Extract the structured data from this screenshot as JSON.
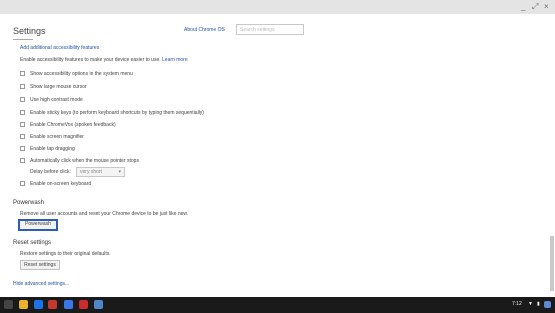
{
  "window": {
    "controls": [
      "_",
      "⤢",
      "×"
    ]
  },
  "header": {
    "title": "Settings",
    "about_link": "About Chrome OS",
    "search_placeholder": "Search settings"
  },
  "accessibility": {
    "link": "Add additional accessibility features",
    "intro": "Enable accessibility features to make your device easier to use.",
    "learn_more": "Learn more",
    "options": [
      "Show accessibility options in the system menu",
      "Show large mouse cursor",
      "Use high contrast mode",
      "Enable sticky keys (to perform keyboard shortcuts by typing them sequentially)",
      "Enable ChromeVox (spoken feedback)",
      "Enable screen magnifier",
      "Enable tap dragging",
      "Automatically click when the mouse pointer stops"
    ],
    "delay_label": "Delay before click:",
    "delay_value": "very short",
    "onscreen_keyboard": "Enable on-screen keyboard"
  },
  "powerwash": {
    "title": "Powerwash",
    "description": "Remove all user accounts and reset your Chrome device to be just like new.",
    "button": "Powerwash"
  },
  "reset": {
    "title": "Reset settings",
    "description": "Restore settings to their original defaults.",
    "button": "Reset settings"
  },
  "hide_advanced": "Hide advanced settings...",
  "shelf": {
    "apps": [
      {
        "name": "chrome-app-icon",
        "color": "#e8b22c"
      },
      {
        "name": "search-app-icon",
        "color": "#1a73e8"
      },
      {
        "name": "gmail-app-icon",
        "color": "#c23a2b"
      },
      {
        "name": "docs-app-icon",
        "color": "#3b78e7"
      },
      {
        "name": "youtube-app-icon",
        "color": "#cc2b2b"
      },
      {
        "name": "files-app-icon",
        "color": "#4f86c6"
      }
    ],
    "status_time": "7:12"
  },
  "colors": {
    "link": "#2255aa",
    "focus_border": "#2d5db0",
    "shelf": "#1a1a1a"
  }
}
